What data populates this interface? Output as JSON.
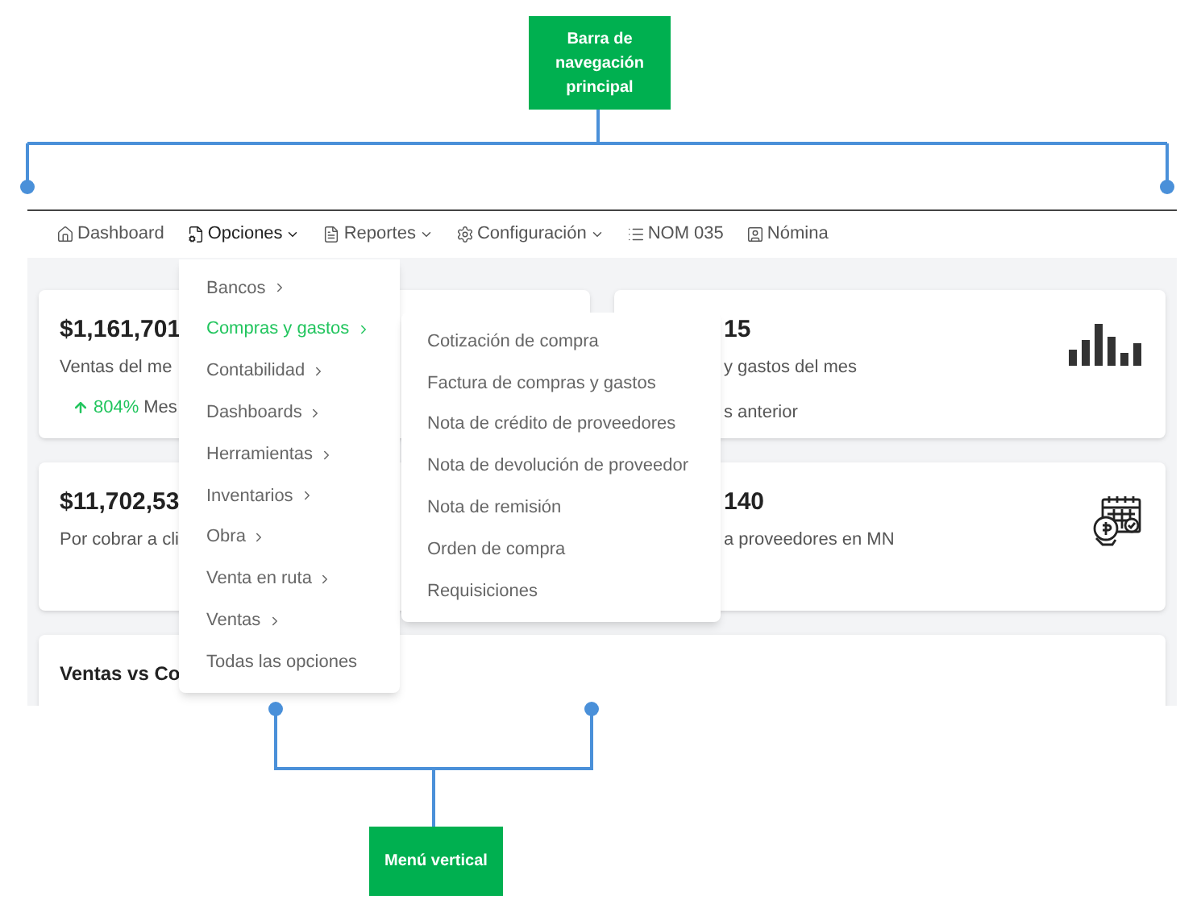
{
  "callouts": [
    {
      "kind": "top",
      "label": "Barra de navegación principal"
    },
    {
      "kind": "bottom",
      "label": "Menú vertical"
    }
  ],
  "navbar": [
    {
      "label": "Dashboard",
      "caret": false,
      "selected": false
    },
    {
      "label": "Opciones",
      "caret": true,
      "selected": true
    },
    {
      "label": "Reportes",
      "caret": true,
      "selected": false
    },
    {
      "label": "Configuración",
      "caret": true,
      "selected": false
    },
    {
      "label": "NOM 035",
      "caret": false,
      "selected": false
    },
    {
      "label": "Nómina",
      "caret": false,
      "selected": false
    }
  ],
  "menu": [
    {
      "label": "Bancos",
      "submenu": true,
      "selected": false
    },
    {
      "label": "Compras y gastos",
      "submenu": true,
      "selected": true
    },
    {
      "label": "Contabilidad",
      "submenu": true,
      "selected": false
    },
    {
      "label": "Dashboards",
      "submenu": true,
      "selected": false
    },
    {
      "label": "Herramientas",
      "submenu": true,
      "selected": false
    },
    {
      "label": "Inventarios",
      "submenu": true,
      "selected": false
    },
    {
      "label": "Obra",
      "submenu": true,
      "selected": false
    },
    {
      "label": "Venta en ruta",
      "submenu": true,
      "selected": false
    },
    {
      "label": "Ventas",
      "submenu": true,
      "selected": false
    },
    {
      "label": "Todas las opciones",
      "submenu": false,
      "selected": false
    }
  ],
  "submenu": [
    "Cotización de compra",
    "Factura de compras y gastos",
    "Nota de crédito de proveedores",
    "Nota de devolución de proveedor",
    "Nota de remisión",
    "Orden de compra",
    "Requisiciones"
  ],
  "cards": [
    {
      "amount": "$1,161,701",
      "caption": "Ventas del me",
      "trend": {
        "value": "804%",
        "label": "Mes"
      }
    },
    {
      "amount": "15",
      "caption": "y gastos del mes",
      "note": "s anterior"
    },
    {
      "amount": "$11,702,53",
      "caption": "Por cobrar a cli"
    },
    {
      "amount": "140",
      "caption": "a proveedores en MN"
    }
  ],
  "chart_card": {
    "title": "Ventas vs Co"
  }
}
